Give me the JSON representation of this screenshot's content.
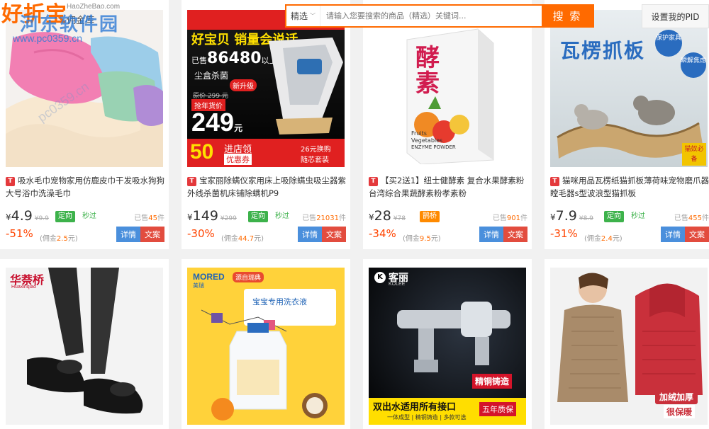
{
  "header": {
    "logo_text": "好折宝",
    "logo_domain": "HaoZheBao.com",
    "logo_sub": "佣金库",
    "watermark_title": "河东软件园",
    "watermark_url": "www.pc0359.cn",
    "search": {
      "scope": "精选",
      "placeholder": "请输入您要搜索的商品（精选）关键词...",
      "button": "搜 索"
    },
    "pid_button": "设置我的PID"
  },
  "products": [
    {
      "platform_badge": "T",
      "title": "吸水毛巾宠物家用仿鹿皮巾干发吸水狗狗大号浴巾洗澡毛巾",
      "price": "4.9",
      "original_price": "¥9.9",
      "tag": "定向",
      "flash": "秒过",
      "sold_label": "已售",
      "sold_count": "45",
      "sold_unit": "件",
      "discount": "-51%",
      "commission_label": "(佣金",
      "commission_value": "2.5",
      "commission_unit": "元)",
      "detail_label": "详情",
      "copy_label": "文案"
    },
    {
      "platform_badge": "T",
      "title": "宝家丽除螨仪家用床上吸除螨虫吸尘器紫外线杀菌机床铺除螨机P9",
      "price": "149",
      "original_price": "¥299",
      "tag": "定向",
      "flash": "秒过",
      "sold_label": "已售",
      "sold_count": "21031",
      "sold_unit": "件",
      "discount": "-30%",
      "commission_label": "(佣金",
      "commission_value": "44.7",
      "commission_unit": "元)",
      "detail_label": "详情",
      "copy_label": "文案",
      "img_text": {
        "headline": "好宝贝 销量会说话",
        "sold_pre": "已售",
        "sold_num": "86480",
        "sold_post": "以上",
        "sub": "尘盒杀菌",
        "new": "新升级",
        "old_price": "原价 299 元",
        "rush": "抢年货价",
        "big_price": "249",
        "yuan": "元",
        "coupon_num": "50",
        "coupon_txt1": "进店领",
        "coupon_txt2": "优惠券",
        "gift1": "26元换购",
        "gift2": "随芯套装"
      }
    },
    {
      "platform_badge": "T",
      "title": "【买2送1】纽士健酵素 复合水果酵素粉 台湾综合果蔬酵素粉孝素粉",
      "price": "28",
      "original_price": "¥78",
      "tag": "鹊桥",
      "flash": "",
      "sold_label": "已售",
      "sold_count": "901",
      "sold_unit": "件",
      "discount": "-34%",
      "commission_label": "(佣金",
      "commission_value": "9.5",
      "commission_unit": "元)",
      "detail_label": "详情",
      "copy_label": "文案",
      "img_text": {
        "main": "酵素",
        "fruits": "Fruits",
        "veg": "Vegetables",
        "enzyme": "ENZYME POWDER"
      }
    },
    {
      "platform_badge": "T",
      "title": "猫咪用品瓦楞纸猫抓板薄荷味宠物磨爪器瞠毛器s型波浪型猫抓板",
      "price": "7.9",
      "original_price": "¥8.9",
      "tag": "定向",
      "flash": "秒过",
      "sold_label": "已售",
      "sold_count": "455",
      "sold_unit": "件",
      "discount": "-31%",
      "commission_label": "(佣金",
      "commission_value": "2.4",
      "commission_unit": "元)",
      "detail_label": "详情",
      "copy_label": "文案",
      "img_text": {
        "headline": "瓦楞抓板",
        "badge1": "保护家具",
        "badge2": "瞬解焦虑",
        "badge3": "猫奴必备"
      }
    },
    {
      "img_text": {
        "brand": "华萘桥",
        "brand_en": "Huaxinqiao"
      }
    },
    {
      "img_text": {
        "brand": "MORED",
        "brand_cn": "美瑞",
        "tag": "源自瑞典",
        "label": "宝宝专用洗衣液"
      }
    },
    {
      "img_text": {
        "brand": "KOLEE",
        "brand_cn": "客丽",
        "slogan1": "双出水适用所有接口",
        "slogan2": "一体成型 | 精铜铸造 | 多款可选",
        "badge1": "精铜铸造",
        "badge2": "五年质保"
      }
    },
    {
      "img_text": {
        "badge1": "加绒加厚",
        "badge2": "很保暖"
      }
    }
  ],
  "colors": {
    "accent": "#ff6a00",
    "discount": "#ff4400",
    "detail_btn": "#4a8fdc",
    "copy_btn": "#e24c3e",
    "tag_green": "#3db24b",
    "tag_orange": "#ff8a00"
  }
}
